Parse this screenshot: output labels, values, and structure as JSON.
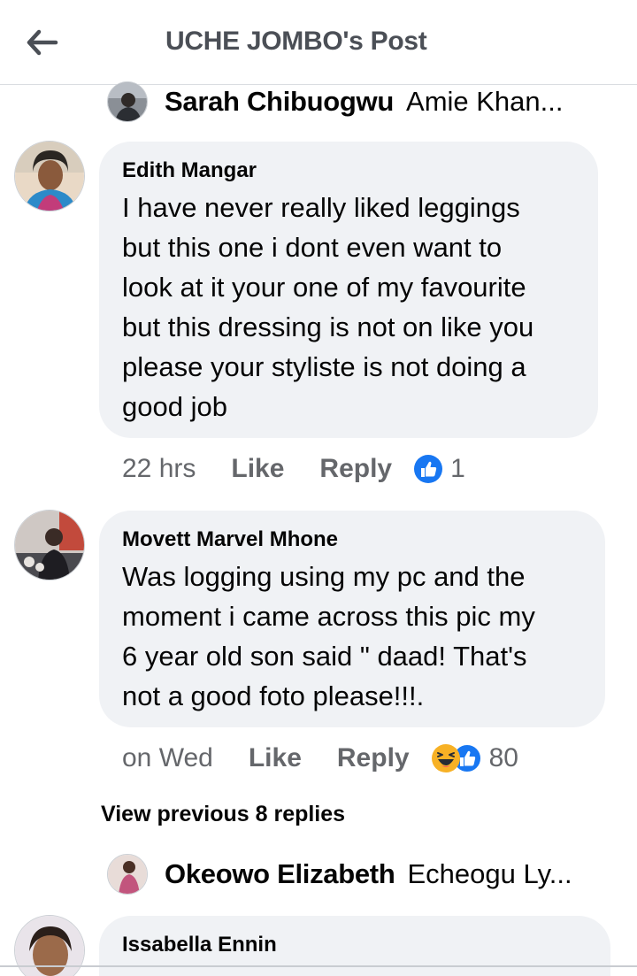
{
  "header": {
    "title": "UCHE JOMBO's Post",
    "back_icon": "arrow-left-icon"
  },
  "colors": {
    "bubble": "#f0f2f5",
    "meta_text": "#65676b",
    "like_blue": "#1877f2",
    "haha_yellow": "#f7b125"
  },
  "replies_top": {
    "name": "Sarah Chibuogwu",
    "snippet": "Amie Khan..."
  },
  "comments": [
    {
      "name": "Edith Mangar",
      "text_lines": [
        "I have never really liked leggings",
        "but this one i dont even want to",
        "look at it your one of my favourite",
        "but this dressing is not on like you",
        "please your styliste is not doing a",
        "good job"
      ],
      "time": "22 hrs",
      "like_label": "Like",
      "reply_label": "Reply",
      "reactions": [
        "like-icon"
      ],
      "reaction_count": "1"
    },
    {
      "name": "Movett Marvel Mhone",
      "text_lines": [
        "Was logging using my pc and the",
        "moment i came across this pic my",
        "6 year old son said \" daad! That's",
        "not a good foto please!!!."
      ],
      "time": "on Wed",
      "like_label": "Like",
      "reply_label": "Reply",
      "reactions": [
        "haha-icon",
        "like-icon"
      ],
      "reaction_count": "80"
    }
  ],
  "view_previous": "View previous 8 replies",
  "replies_bottom": {
    "name": "Okeowo Elizabeth",
    "snippet": "Echeogu Ly..."
  },
  "partial_comment": {
    "name": "Issabella Ennin"
  }
}
